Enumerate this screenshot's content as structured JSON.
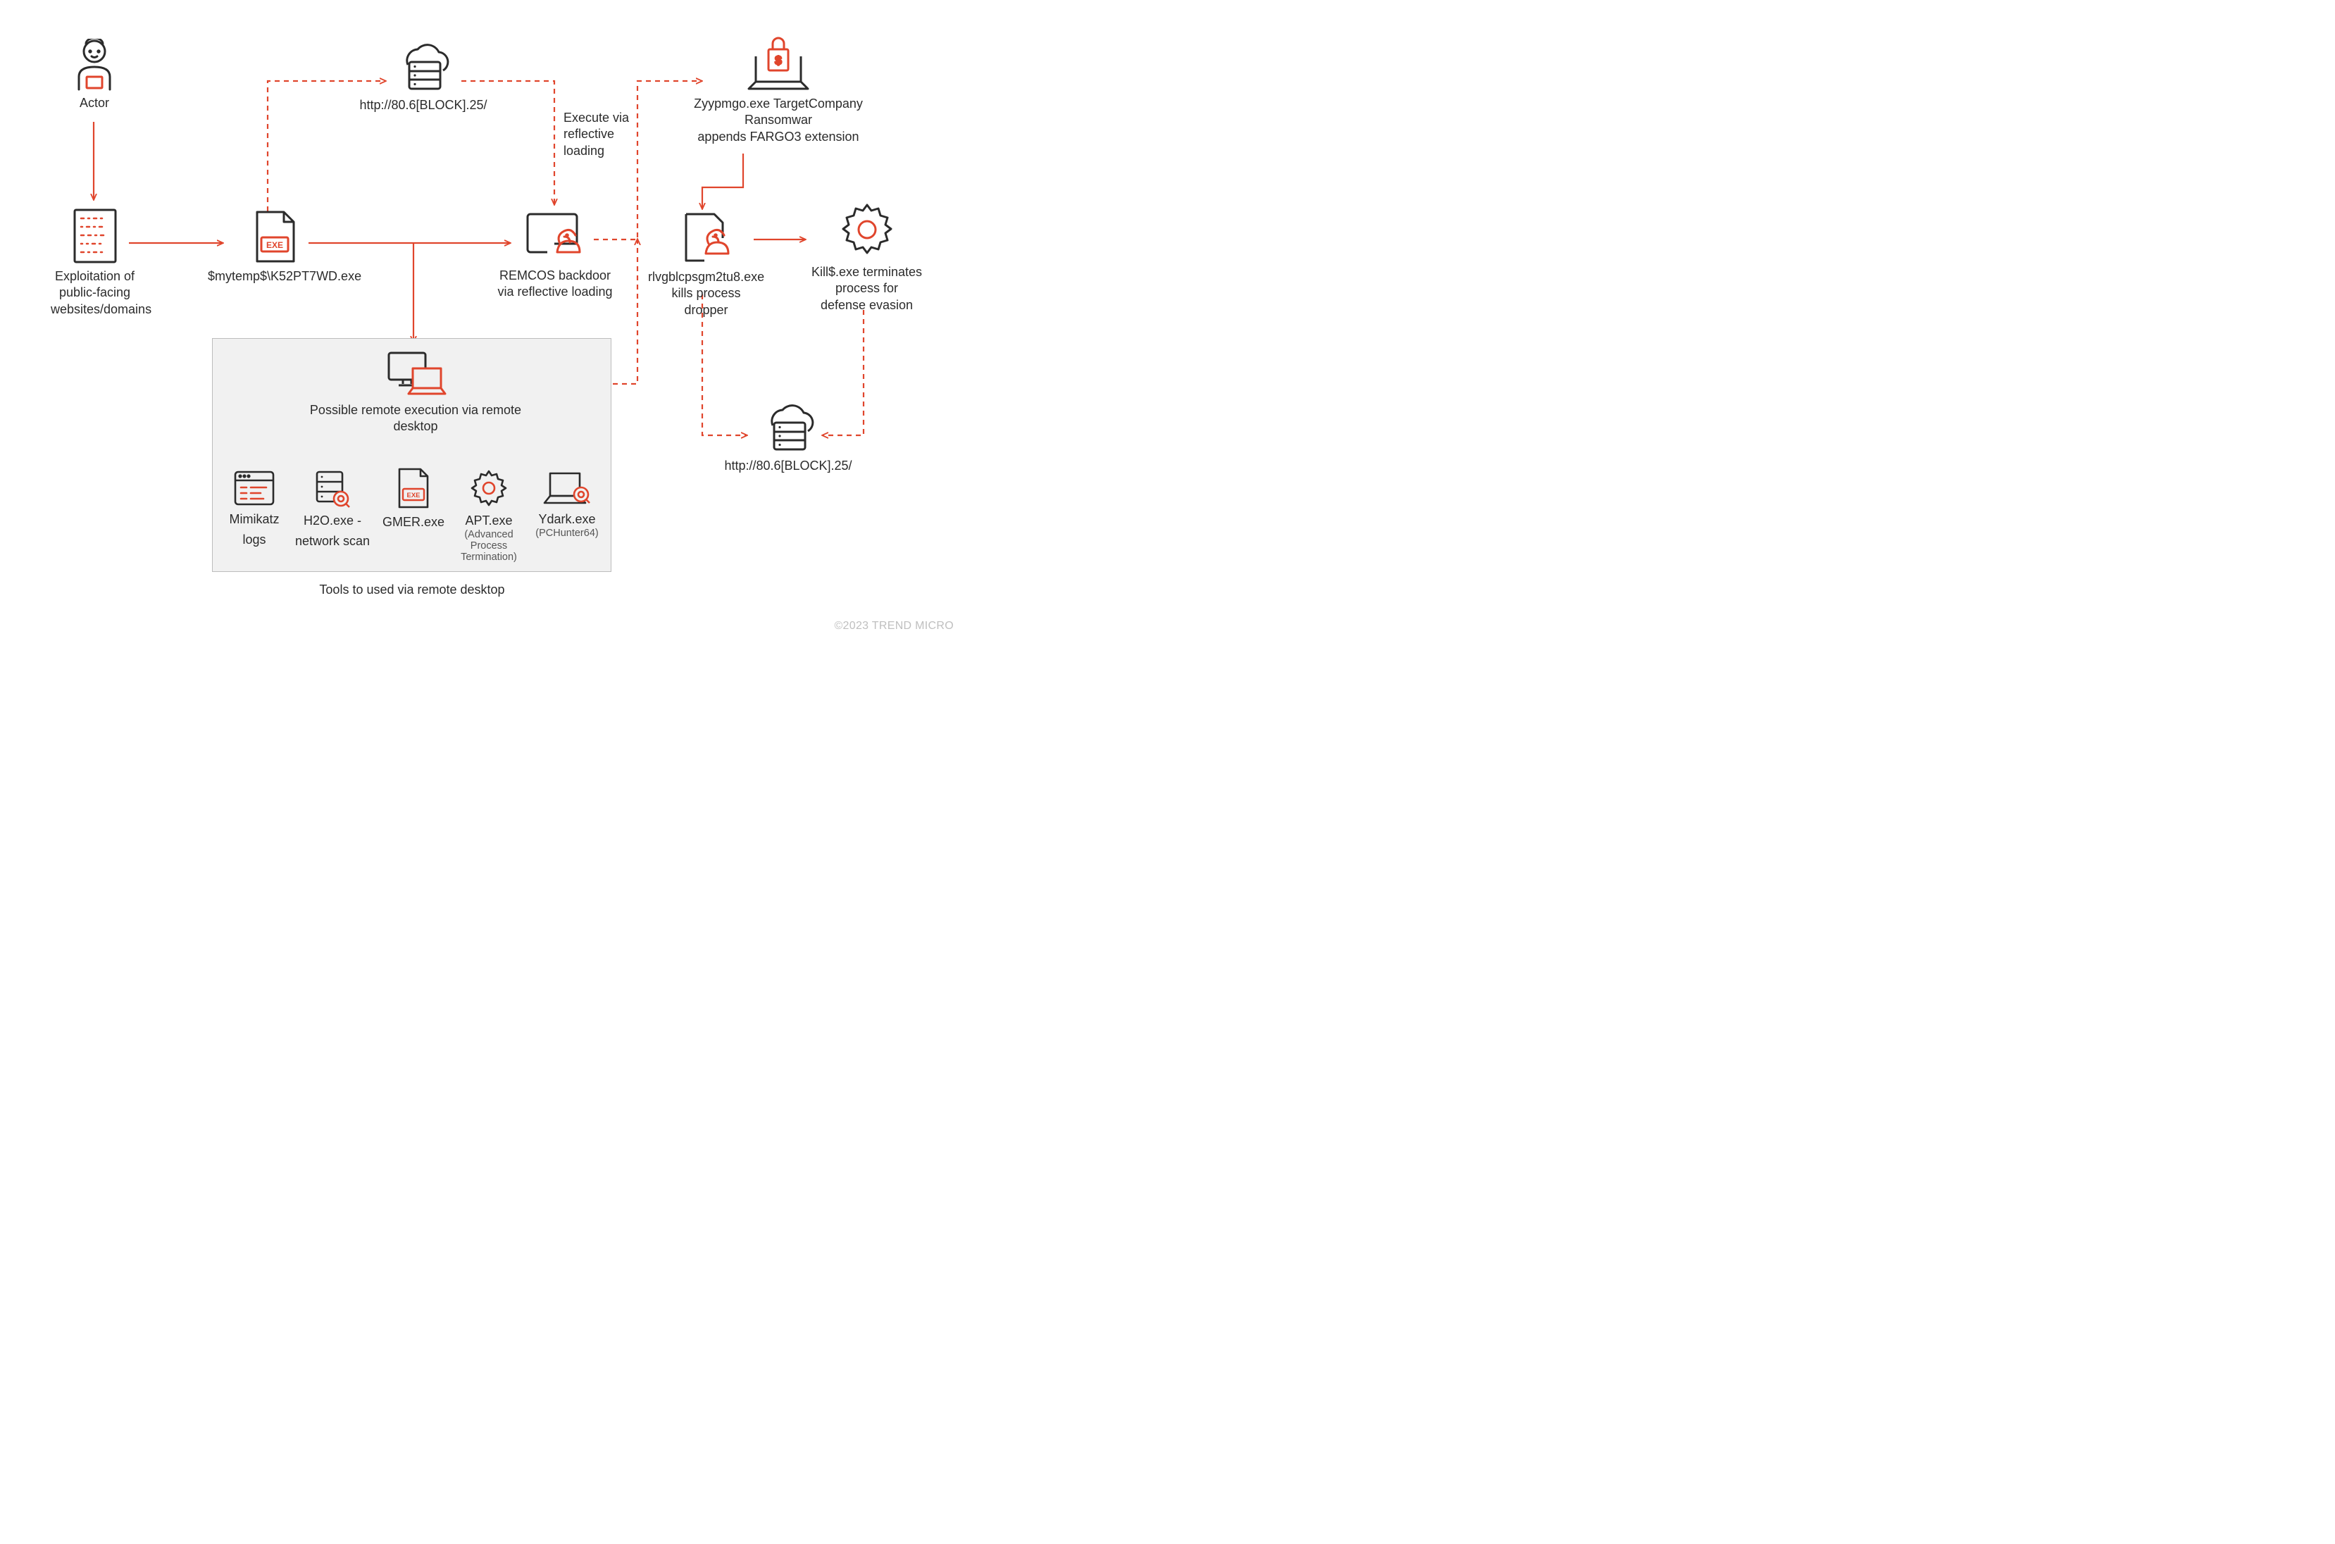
{
  "actor_label": "Actor",
  "exploitation_label": "Exploitation of\npublic-facing\nwebsites/domains",
  "exe_label": "$mytemp$\\K52PT7WD.exe",
  "c2_label_1": "http://80.6[BLOCK].25/",
  "reflective_text": "Execute via\nreflective\nloading",
  "remcos_label": "REMCOS backdoor\nvia reflective loading",
  "ransomware_label": "Zyypmgo.exe TargetCompany Ransomwar\nappends FARGO3 extension",
  "dropper_label": "rlvgblcpsgm2tu8.exe\nkills process dropper",
  "kill_label": "Kill$.exe terminates\nprocess for\ndefense evasion",
  "c2_label_2": "http://80.6[BLOCK].25/",
  "remote_exec_label": "Possible remote execution via remote desktop",
  "tools_footer": "Tools to used via remote desktop",
  "tools": {
    "mimikatz": {
      "name": "Mimikatz",
      "sub": "logs"
    },
    "h2o": {
      "name": "H2O.exe -",
      "sub": "network scan"
    },
    "gmer": {
      "name": "GMER.exe",
      "sub": ""
    },
    "apt": {
      "name": "APT.exe",
      "sub": "(Advanced Process\nTermination)"
    },
    "ydark": {
      "name": "Ydark.exe",
      "sub": "(PCHunter64)"
    }
  },
  "copyright": "©2023 TREND MICRO",
  "colors": {
    "red": "#e0452c",
    "dark": "#2b2b2b",
    "grey": "#f1f1f1",
    "border": "#bcbcbc"
  }
}
